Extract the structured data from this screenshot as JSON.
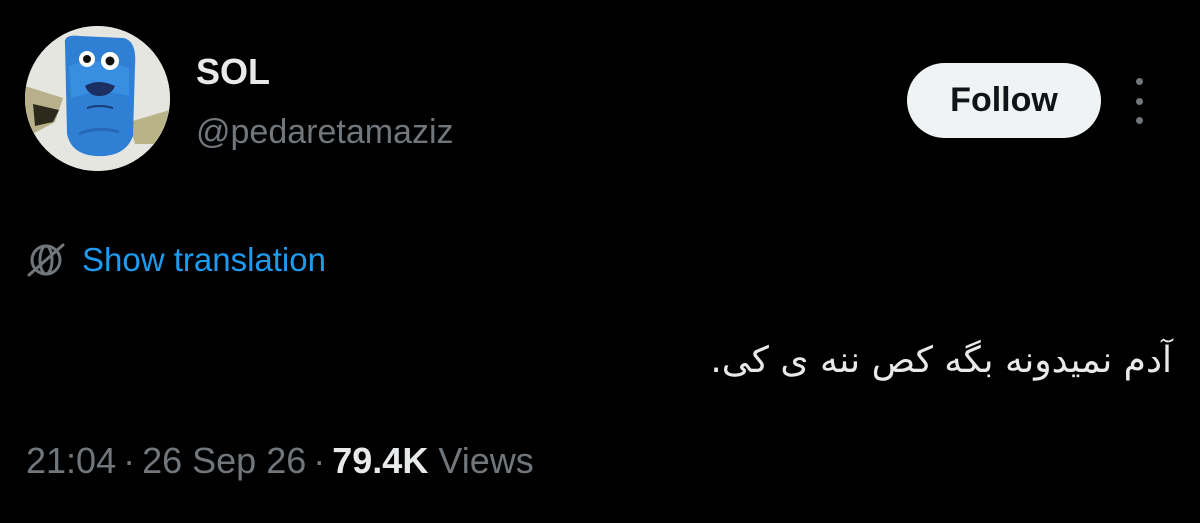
{
  "user": {
    "display_name": "SOL",
    "handle": "@pedaretamaziz",
    "avatar_icon": "blue-fish-avatar"
  },
  "actions": {
    "follow_label": "Follow",
    "more_icon": "more-vertical-icon"
  },
  "translation": {
    "icon": "globe-icon",
    "label": "Show translation"
  },
  "tweet": {
    "text": "آدم نمیدونه بگه کص ننه ی کی."
  },
  "meta": {
    "time": "21:04",
    "separator": "·",
    "date": "26 Sep 26",
    "views_count": "79.4K",
    "views_label": "Views"
  },
  "colors": {
    "background": "#000000",
    "primary_text": "#e7e9ea",
    "secondary_text": "#71767b",
    "link": "#1d9bf0",
    "follow_bg": "#eff3f4"
  }
}
